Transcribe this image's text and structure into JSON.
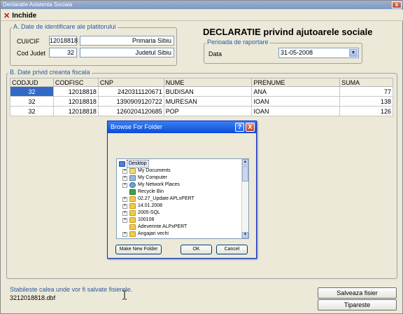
{
  "window": {
    "title": "Declaratie Asistenta Sociala",
    "close_glyph": "x"
  },
  "toolbar": {
    "close_label": "Inchide"
  },
  "section_a": {
    "legend": "A. Date de identificare ale platitorului",
    "cui_label": "CUI/CIF",
    "cui_value": "12018818",
    "cui_name": "Primaria Sibiu",
    "judet_label": "Cod Judet",
    "judet_value": "32",
    "judet_name": "Judetul Sibiu"
  },
  "main_title": "DECLARATIE privind ajutoarele sociale",
  "period": {
    "legend": "Perioada de raportare",
    "date_label": "Data",
    "date_value": "31-05-2008"
  },
  "section_b": {
    "legend": "B. Date privid creanta fiscala",
    "columns": [
      "CODJUD",
      "CODFISC",
      "CNP",
      "NUME",
      "PRENUME",
      "SUMA"
    ],
    "rows": [
      [
        "32",
        "12018818",
        "2420311120671",
        "BUDISAN",
        "ANA",
        "77"
      ],
      [
        "32",
        "12018818",
        "1390909120722",
        "MURESAN",
        "IOAN",
        "138"
      ],
      [
        "32",
        "12018818",
        "1260204120685",
        "POP",
        "IOAN",
        "126"
      ]
    ]
  },
  "dialog": {
    "title": "Browse For Folder",
    "help": "?",
    "close": "X",
    "tree": [
      {
        "label": "Desktop",
        "icon": "desktop-icon",
        "level": 0,
        "expander": "",
        "selected": true
      },
      {
        "label": "My Documents",
        "icon": "documents-icon",
        "level": 1,
        "expander": "+"
      },
      {
        "label": "My Computer",
        "icon": "computer-icon",
        "level": 1,
        "expander": "+"
      },
      {
        "label": "My Network Places",
        "icon": "network-icon",
        "level": 1,
        "expander": "+"
      },
      {
        "label": "Recycle Bin",
        "icon": "recycle-bin-icon",
        "level": 1,
        "expander": ""
      },
      {
        "label": "02.27_Update APLxPERT",
        "icon": "folder-icon",
        "level": 1,
        "expander": "+"
      },
      {
        "label": "14.01.2008",
        "icon": "folder-icon",
        "level": 1,
        "expander": "+"
      },
      {
        "label": "2005-SQL",
        "icon": "folder-icon",
        "level": 1,
        "expander": "+"
      },
      {
        "label": "100108",
        "icon": "folder-icon",
        "level": 1,
        "expander": "+"
      },
      {
        "label": "Adeverinte ALPxPERT",
        "icon": "folder-icon",
        "level": 1,
        "expander": ""
      },
      {
        "label": "Angajari vechi",
        "icon": "folder-icon",
        "level": 1,
        "expander": "+"
      }
    ],
    "make_folder_label": "Make New Folder",
    "ok_label": "OK",
    "cancel_label": "Cancel"
  },
  "footer": {
    "hint": "Stabileste calea unde vor fi salvate fisierele.",
    "filename": "3212018818.dbf",
    "save_label": "Salveaza fisier",
    "print_label": "Tipareste"
  }
}
